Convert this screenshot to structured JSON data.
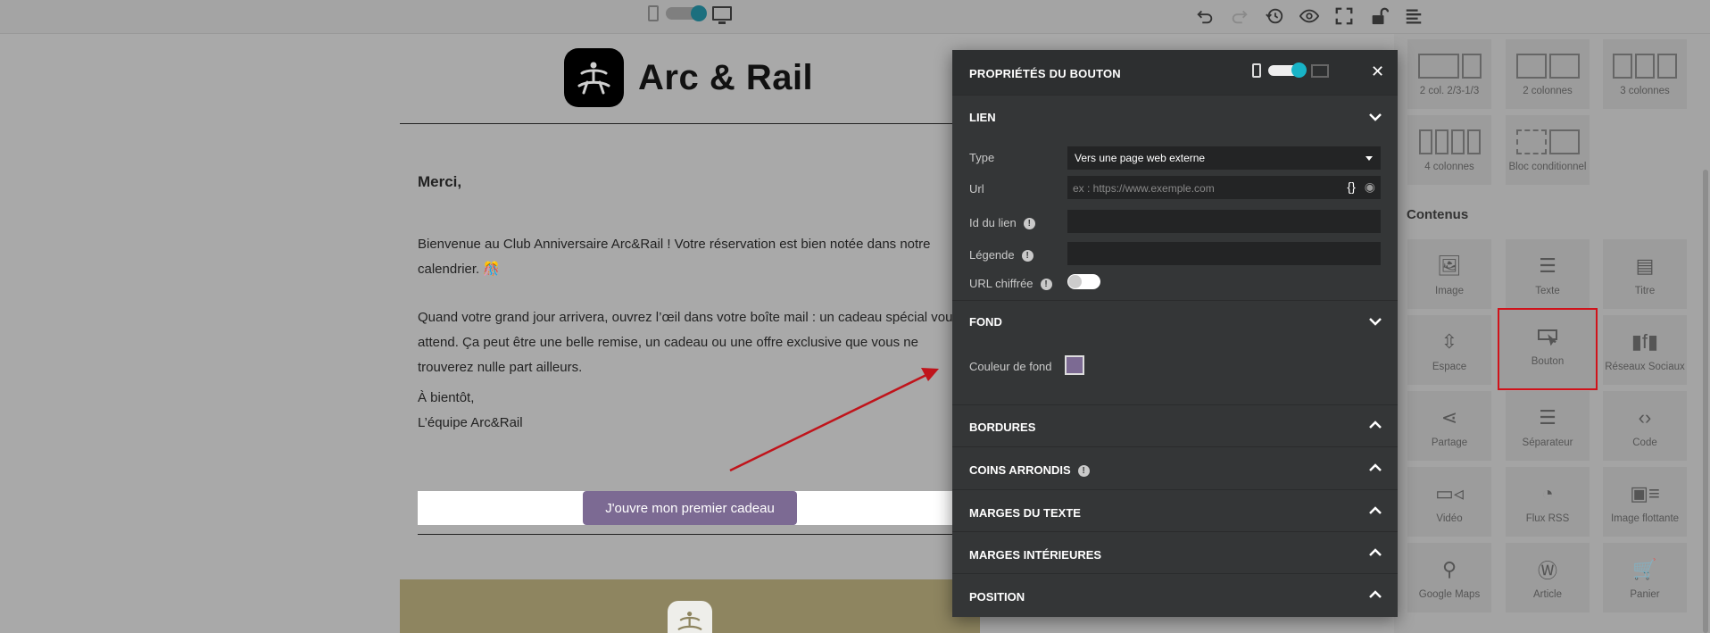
{
  "colors": {
    "cta_background": "#7c6a93",
    "accent_toggle": "#18b3c6",
    "highlight": "#d0121a",
    "panel_background": "#343637",
    "footer_band": "#8e8560"
  },
  "toolbar": {
    "icons": [
      "undo-icon",
      "redo-icon",
      "history-icon",
      "preview-eye-icon",
      "fullscreen-icon",
      "lock-icon",
      "outline-icon"
    ]
  },
  "email": {
    "brand_name": "Arc & Rail",
    "greeting": "Merci,",
    "paragraph1": "Bienvenue au Club Anniversaire Arc&Rail ! Votre réservation est bien notée dans notre calendrier. 🎊",
    "paragraph2": "Quand votre grand jour arrivera, ouvrez l’œil dans votre boîte mail : un cadeau spécial vous y attend. Ça peut être une belle remise, un cadeau ou une offre exclusive que vous ne trouverez nulle part ailleurs.",
    "signoff1": "À bientôt,",
    "signoff2": "L’équipe Arc&Rail",
    "cta_label": "J'ouvre mon premier cadeau"
  },
  "panel": {
    "title": "PROPRIÉTÉS DU BOUTON",
    "sections": {
      "link": "LIEN",
      "background": "FOND",
      "borders": "BORDURES",
      "corners": "COINS ARRONDIS",
      "text_margins": "MARGES DU TEXTE",
      "inner_margins": "MARGES INTÉRIEURES",
      "position": "POSITION"
    },
    "link": {
      "type_label": "Type",
      "type_value": "Vers une page web externe",
      "url_label": "Url",
      "url_placeholder": "ex : https://www.exemple.com",
      "url_vars": "{}",
      "id_label": "Id du lien",
      "caption_label": "Légende",
      "encrypted_label": "URL chiffrée"
    },
    "background": {
      "color_label": "Couleur de fond"
    }
  },
  "palette": {
    "layouts": [
      {
        "label": "2 col. 2/3-1/3"
      },
      {
        "label": "2 colonnes"
      },
      {
        "label": "3 colonnes"
      },
      {
        "label": "4 colonnes"
      },
      {
        "label": "Bloc conditionnel"
      }
    ],
    "contents_title": "Contenus",
    "contents": [
      {
        "label": "Image",
        "icon": "image-icon"
      },
      {
        "label": "Texte",
        "icon": "text-icon"
      },
      {
        "label": "Titre",
        "icon": "title-icon"
      },
      {
        "label": "Espace",
        "icon": "spacer-icon"
      },
      {
        "label": "Bouton",
        "icon": "button-icon"
      },
      {
        "label": "Réseaux Sociaux",
        "icon": "social-icon"
      },
      {
        "label": "Partage",
        "icon": "share-icon"
      },
      {
        "label": "Séparateur",
        "icon": "divider-icon"
      },
      {
        "label": "Code",
        "icon": "code-icon"
      },
      {
        "label": "Vidéo",
        "icon": "video-icon"
      },
      {
        "label": "Flux RSS",
        "icon": "rss-icon"
      },
      {
        "label": "Image flottante",
        "icon": "floating-image-icon"
      },
      {
        "label": "Google Maps",
        "icon": "map-pin-icon"
      },
      {
        "label": "Article",
        "icon": "wordpress-icon"
      },
      {
        "label": "Panier",
        "icon": "cart-icon"
      }
    ]
  }
}
